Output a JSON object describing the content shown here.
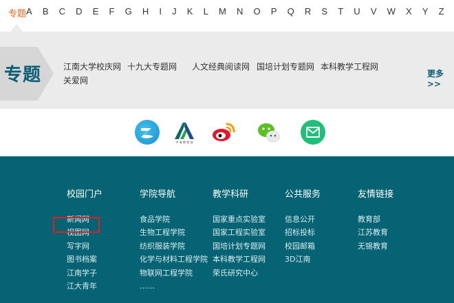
{
  "alphabet": {
    "active": "专题",
    "letters": [
      "A",
      "B",
      "C",
      "D",
      "E",
      "F",
      "G",
      "H",
      "I",
      "J",
      "K",
      "L",
      "M",
      "N",
      "O",
      "P",
      "Q",
      "R",
      "S",
      "T",
      "U",
      "V",
      "W",
      "X",
      "Y",
      "Z"
    ]
  },
  "topics": {
    "badge": "专题",
    "links": [
      "江南大学校庆网",
      "十九大专题网",
      "人文经典阅读网",
      "国培计划专题网",
      "本科教学工程网",
      "关爱网"
    ],
    "more": "更多>>"
  },
  "social": {
    "icons": [
      "app-logo-icon",
      "education-bureau-logo-icon",
      "weibo-icon",
      "wechat-icon",
      "mail-icon"
    ],
    "logo_text": "中 青 教 育 部"
  },
  "footer": {
    "columns": [
      {
        "title": "校园门户",
        "links": [
          "新闻网",
          "视图网",
          "写字网",
          "图书档案",
          "江南学子",
          "江大青年"
        ]
      },
      {
        "title": "学院导航",
        "links": [
          "食品学院",
          "生物工程学院",
          "纺织服装学院",
          "化学与材料工程学院",
          "物联网工程学院",
          "……"
        ]
      },
      {
        "title": "教学科研",
        "links": [
          "国家重点实验室",
          "国家工程实验室",
          "国培计划专题网",
          "本科教学工程网",
          "荣氏研究中心"
        ]
      },
      {
        "title": "公共服务",
        "links": [
          "信息公开",
          "招标投标",
          "校园邮箱",
          "3D江南"
        ]
      },
      {
        "title": "友情链接",
        "links": [
          "教育部",
          "江苏教育",
          "无锡教育"
        ]
      }
    ]
  },
  "colors": {
    "accent": "#e8641e",
    "footer_bg": "#066373",
    "brand": "#0b5f75",
    "highlight": "#e02020"
  }
}
